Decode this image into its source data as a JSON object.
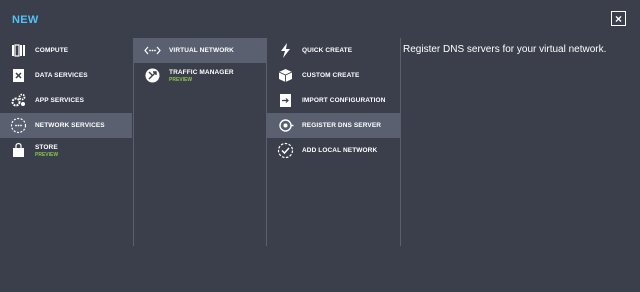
{
  "header": {
    "title": "NEW",
    "close_symbol": "×"
  },
  "col1": {
    "items": [
      {
        "label": "COMPUTE",
        "icon": "compute-icon"
      },
      {
        "label": "DATA SERVICES",
        "icon": "data-services-icon"
      },
      {
        "label": "APP SERVICES",
        "icon": "app-services-icon"
      },
      {
        "label": "NETWORK SERVICES",
        "icon": "network-services-icon",
        "selected": true
      },
      {
        "label": "STORE",
        "sub": "PREVIEW",
        "icon": "store-icon"
      }
    ]
  },
  "col2": {
    "items": [
      {
        "label": "VIRTUAL NETWORK",
        "icon": "virtual-network-icon",
        "selected": true
      },
      {
        "label": "TRAFFIC MANAGER",
        "sub": "PREVIEW",
        "icon": "traffic-manager-icon"
      }
    ]
  },
  "col3": {
    "items": [
      {
        "label": "QUICK CREATE",
        "icon": "lightning-icon"
      },
      {
        "label": "CUSTOM CREATE",
        "icon": "box-icon"
      },
      {
        "label": "IMPORT CONFIGURATION",
        "icon": "import-icon"
      },
      {
        "label": "REGISTER DNS SERVER",
        "icon": "dns-server-icon",
        "selected": true
      },
      {
        "label": "ADD LOCAL NETWORK",
        "icon": "checkmark-circle-icon"
      }
    ]
  },
  "description": "Register DNS servers for your virtual network.",
  "colors": {
    "accent": "#4fc3f7",
    "preview": "#8bc34a",
    "selected_bg": "#5a6070",
    "background": "#3a3f4b"
  }
}
